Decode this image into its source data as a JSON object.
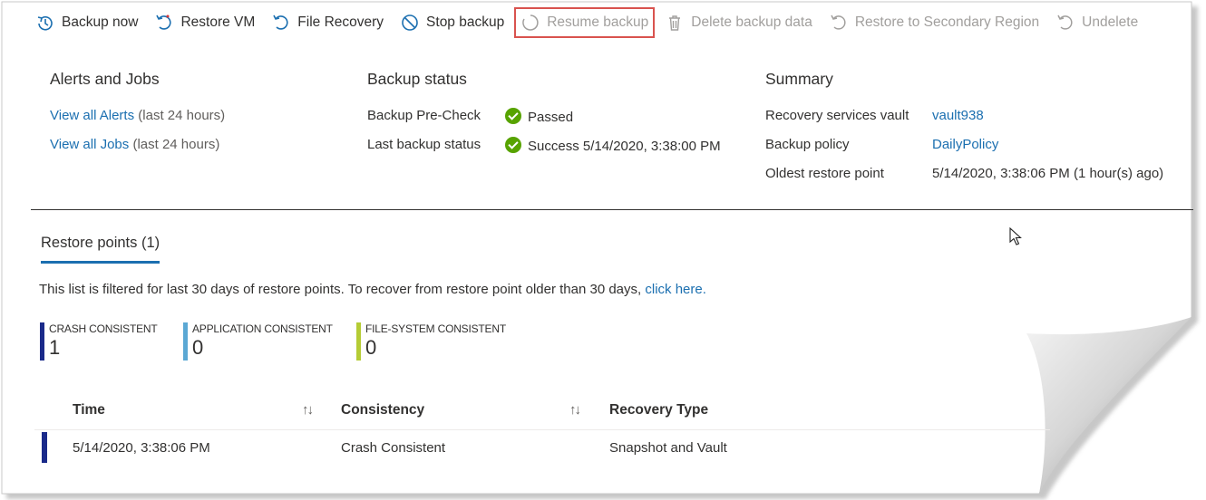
{
  "toolbar": {
    "items": [
      {
        "label": "Backup now",
        "icon": "backup-now-icon",
        "disabled": false
      },
      {
        "label": "Restore VM",
        "icon": "restore-vm-icon",
        "disabled": false
      },
      {
        "label": "File Recovery",
        "icon": "file-recovery-icon",
        "disabled": false
      },
      {
        "label": "Stop backup",
        "icon": "stop-icon",
        "disabled": false
      },
      {
        "label": "Resume backup",
        "icon": "resume-icon",
        "disabled": true
      },
      {
        "label": "Delete backup data",
        "icon": "trash-icon",
        "disabled": true
      },
      {
        "label": "Restore to Secondary Region",
        "icon": "restore-secondary-icon",
        "disabled": true
      },
      {
        "label": "Undelete",
        "icon": "undelete-icon",
        "disabled": true
      }
    ]
  },
  "alerts": {
    "title": "Alerts and Jobs",
    "alerts_link": "View all Alerts",
    "alerts_note": "(last 24 hours)",
    "jobs_link": "View all Jobs",
    "jobs_note": "(last 24 hours)"
  },
  "backup_status": {
    "title": "Backup status",
    "precheck_label": "Backup Pre-Check",
    "precheck_value": "Passed",
    "last_label": "Last backup status",
    "last_value": "Success 5/14/2020, 3:38:00 PM"
  },
  "summary": {
    "title": "Summary",
    "vault_label": "Recovery services vault",
    "vault_value": "vault938",
    "policy_label": "Backup policy",
    "policy_value": "DailyPolicy",
    "oldest_label": "Oldest restore point",
    "oldest_value": "5/14/2020, 3:38:06 PM (1 hour(s) ago)"
  },
  "restore": {
    "tab_label": "Restore points (1)",
    "filter_text": "This list is filtered for last 30 days of restore points. To recover from restore point older than 30 days,",
    "filter_link": "click here.",
    "kpis": [
      {
        "label": "CRASH CONSISTENT",
        "value": "1",
        "color": "#1a2a8a"
      },
      {
        "label": "APPLICATION CONSISTENT",
        "value": "0",
        "color": "#5ba8d4"
      },
      {
        "label": "FILE-SYSTEM CONSISTENT",
        "value": "0",
        "color": "#b5cc35"
      }
    ],
    "columns": [
      "Time",
      "Consistency",
      "Recovery Type"
    ],
    "sort_glyph": "↑↓",
    "rows": [
      {
        "time": "5/14/2020, 3:38:06 PM",
        "consistency": "Crash Consistent",
        "recovery_type": "Snapshot and Vault"
      }
    ]
  },
  "colors": {
    "link": "#1b6fb0",
    "success": "#57a300",
    "highlight": "#d9534f"
  }
}
